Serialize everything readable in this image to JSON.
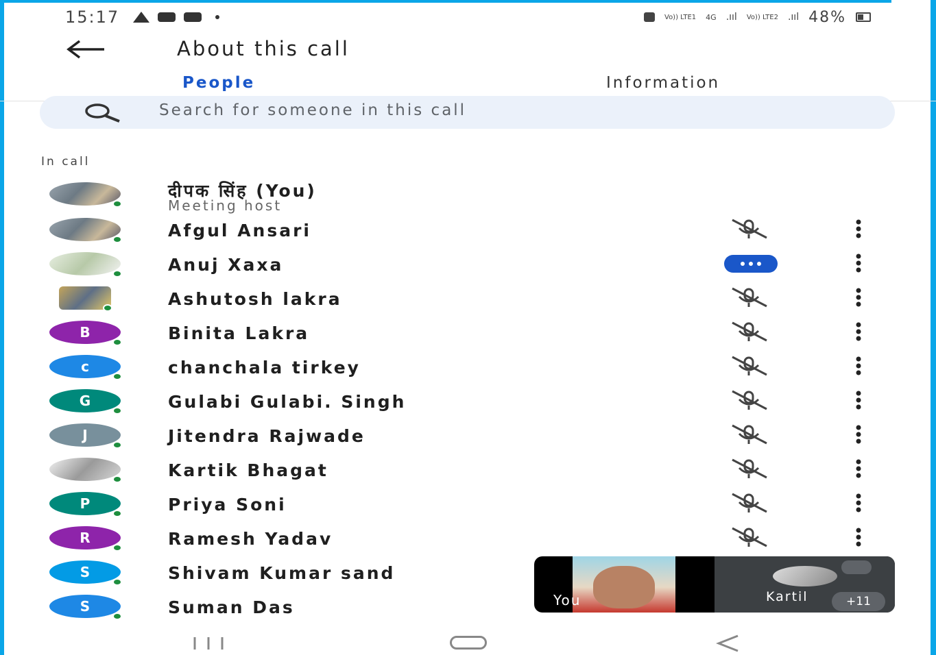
{
  "status_bar": {
    "time": "15:17",
    "battery_text": "48%",
    "network_labels": [
      "Vo)) LTE1",
      "4G",
      "Vo)) LTE2"
    ]
  },
  "header": {
    "title": "About this call"
  },
  "tabs": [
    {
      "label": "People",
      "active": true
    },
    {
      "label": "Information",
      "active": false
    }
  ],
  "search": {
    "placeholder": "Search for someone in this call"
  },
  "section": {
    "label": "In call"
  },
  "participants": [
    {
      "name": "दीपक सिंह (You)",
      "subtitle": "Meeting host",
      "avatar": "photo",
      "status": "none"
    },
    {
      "name": "Afgul Ansari",
      "avatar": "photo",
      "status": "mic-off"
    },
    {
      "name": "Anuj Xaxa",
      "avatar": "photo",
      "status": "speaking"
    },
    {
      "name": "Ashutosh lakra",
      "avatar": "photo",
      "status": "mic-off"
    },
    {
      "name": "Binita Lakra",
      "avatar": "B",
      "avatar_color": "#8e24aa",
      "status": "mic-off"
    },
    {
      "name": "chanchala tirkey",
      "avatar": "c",
      "avatar_color": "#1e88e5",
      "status": "mic-off"
    },
    {
      "name": "Gulabi Gulabi. Singh",
      "avatar": "G",
      "avatar_color": "#00897b",
      "status": "mic-off"
    },
    {
      "name": "Jitendra Rajwade",
      "avatar": "J",
      "avatar_color": "#78909c",
      "status": "mic-off"
    },
    {
      "name": "Kartik Bhagat",
      "avatar": "photo",
      "status": "mic-off"
    },
    {
      "name": "Priya Soni",
      "avatar": "P",
      "avatar_color": "#00897b",
      "status": "mic-off"
    },
    {
      "name": "Ramesh Yadav",
      "avatar": "R",
      "avatar_color": "#8e24aa",
      "status": "mic-off"
    },
    {
      "name": "Shivam Kumar sand",
      "avatar": "S",
      "avatar_color": "#039be5",
      "status": "none"
    },
    {
      "name": "Suman Das",
      "avatar": "S",
      "avatar_color": "#1e88e5",
      "status": "none"
    }
  ],
  "pip": {
    "self_label": "You",
    "other_label": "Kartil",
    "extra_count": "+11"
  },
  "colors": {
    "accent": "#1a57c9",
    "online": "#1e8e3e",
    "frame": "#0aa6e8"
  },
  "icons": {
    "back": "arrow-left-icon",
    "search": "search-icon",
    "mic_off": "mic-off-icon",
    "more": "more-vert-icon"
  }
}
